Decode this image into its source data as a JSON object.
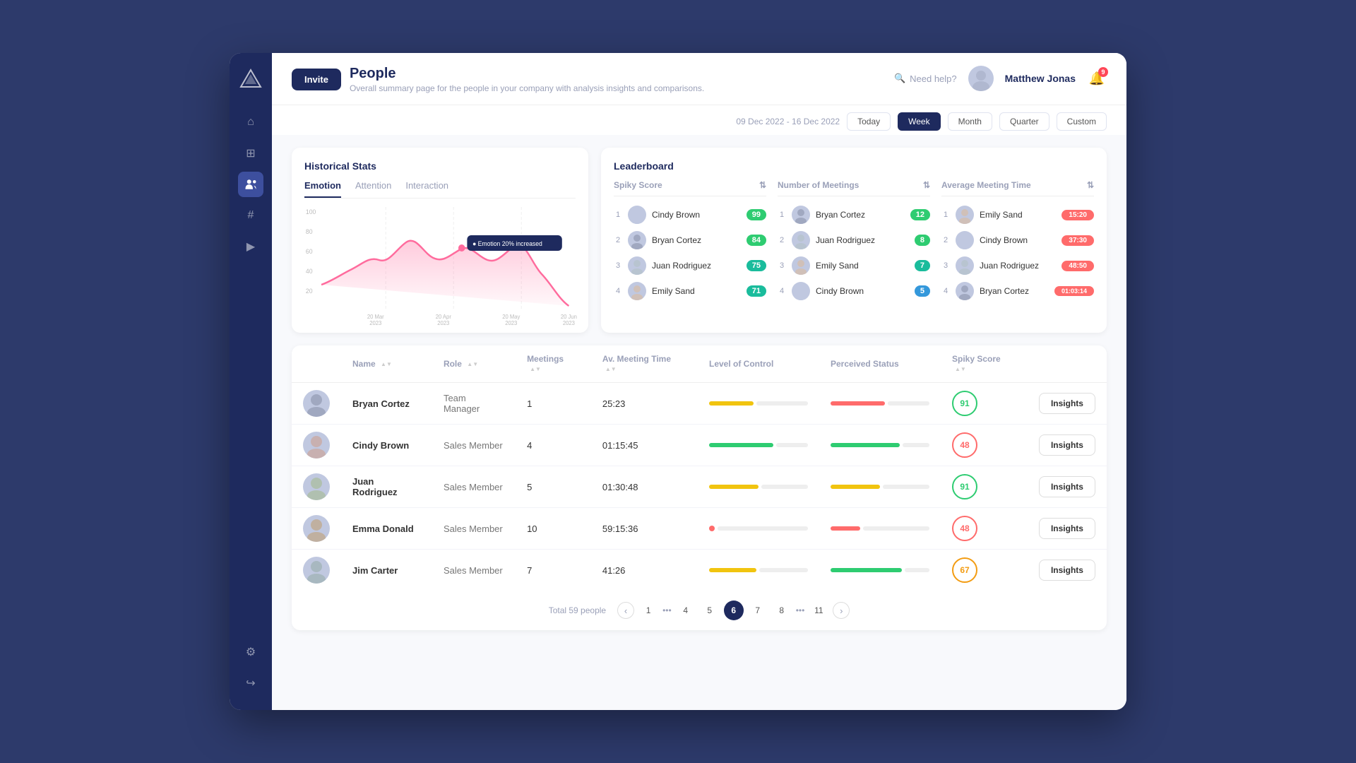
{
  "app": {
    "title": "People",
    "subtitle": "Overall summary page for the people in your company with analysis insights and comparisons."
  },
  "header": {
    "invite_label": "Invite",
    "search_label": "Need help?",
    "username": "Matthew Jonas",
    "notification_count": "9"
  },
  "date_filter": {
    "date_range": "09 Dec 2022 - 16 Dec 2022",
    "options": [
      "Today",
      "Week",
      "Month",
      "Quarter",
      "Custom"
    ],
    "active": "Week"
  },
  "historical_stats": {
    "title": "Historical Stats",
    "tabs": [
      "Emotion",
      "Attention",
      "Interaction"
    ],
    "active_tab": "Emotion",
    "tooltip": "Emotion 20% increased",
    "chart_x_labels": [
      "20 Mar\n2023",
      "20 Apr\n2023",
      "20 May\n2023",
      "20 Jun\n2023"
    ],
    "chart_y_labels": [
      "100",
      "80",
      "60",
      "40",
      "20"
    ]
  },
  "leaderboard": {
    "title": "Leaderboard",
    "columns": [
      {
        "header": "Spiky Score",
        "rows": [
          {
            "rank": "1",
            "name": "Cindy Brown",
            "score": "99",
            "color": "green"
          },
          {
            "rank": "2",
            "name": "Bryan Cortez",
            "score": "84",
            "color": "green"
          },
          {
            "rank": "3",
            "name": "Juan Rodriguez",
            "score": "75",
            "color": "teal"
          },
          {
            "rank": "4",
            "name": "Emily Sand",
            "score": "71",
            "color": "teal"
          }
        ]
      },
      {
        "header": "Number of Meetings",
        "rows": [
          {
            "rank": "1",
            "name": "Bryan Cortez",
            "score": "12",
            "color": "green"
          },
          {
            "rank": "2",
            "name": "Juan Rodriguez",
            "score": "8",
            "color": "green"
          },
          {
            "rank": "3",
            "name": "Emily Sand",
            "score": "7",
            "color": "teal"
          },
          {
            "rank": "4",
            "name": "Cindy Brown",
            "score": "5",
            "color": "blue"
          }
        ]
      },
      {
        "header": "Average Meeting Time",
        "rows": [
          {
            "rank": "1",
            "name": "Emily Sand",
            "score": "15:20",
            "color": "red"
          },
          {
            "rank": "2",
            "name": "Cindy Brown",
            "score": "37:30",
            "color": "red"
          },
          {
            "rank": "3",
            "name": "Juan Rodriguez",
            "score": "48:50",
            "color": "red"
          },
          {
            "rank": "4",
            "name": "Bryan Cortez",
            "score": "01:03:14",
            "color": "red"
          }
        ]
      }
    ]
  },
  "table": {
    "columns": [
      "Name",
      "Role",
      "Meetings",
      "Av. Meeting Time",
      "Level of Control",
      "Perceived Status",
      "Spiky Score",
      ""
    ],
    "rows": [
      {
        "name": "Bryan Cortez",
        "role": "Team Manager",
        "meetings": "1",
        "avg_time": "25:23",
        "loc_fill": 45,
        "loc_color": "#f1c40f",
        "ps_fill": 55,
        "ps_color": "#ff6b6b",
        "score": "91",
        "score_color": "#2ecc71",
        "insights": "Insights"
      },
      {
        "name": "Cindy Brown",
        "role": "Sales Member",
        "meetings": "4",
        "avg_time": "01:15:45",
        "loc_fill": 65,
        "loc_color": "#2ecc71",
        "ps_fill": 70,
        "ps_color": "#2ecc71",
        "score": "48",
        "score_color": "#ff6b6b",
        "insights": "Insights"
      },
      {
        "name": "Juan Rodriguez",
        "role": "Sales Member",
        "meetings": "5",
        "avg_time": "01:30:48",
        "loc_fill": 50,
        "loc_color": "#f1c40f",
        "ps_fill": 50,
        "ps_color": "#f1c40f",
        "score": "91",
        "score_color": "#2ecc71",
        "insights": "Insights"
      },
      {
        "name": "Emma Donald",
        "role": "Sales Member",
        "meetings": "10",
        "avg_time": "59:15:36",
        "loc_fill": 8,
        "loc_color": "#ff6b6b",
        "ps_fill": 30,
        "ps_color": "#ff6b6b",
        "score": "48",
        "score_color": "#ff6b6b",
        "insights": "Insights"
      },
      {
        "name": "Jim Carter",
        "role": "Sales Member",
        "meetings": "7",
        "avg_time": "41:26",
        "loc_fill": 48,
        "loc_color": "#f1c40f",
        "ps_fill": 72,
        "ps_color": "#2ecc71",
        "score": "67",
        "score_color": "#f39c12",
        "insights": "Insights"
      }
    ]
  },
  "pagination": {
    "total": "Total 59 people",
    "pages": [
      "1",
      "...",
      "4",
      "5",
      "6",
      "7",
      "8",
      "...",
      "11"
    ],
    "active": "6"
  },
  "sidebar": {
    "items": [
      {
        "icon": "⌂",
        "name": "home"
      },
      {
        "icon": "⊞",
        "name": "grid"
      },
      {
        "icon": "👤",
        "name": "people"
      },
      {
        "icon": "#",
        "name": "hashtag"
      },
      {
        "icon": "▶",
        "name": "play"
      }
    ],
    "bottom": [
      {
        "icon": "⚙",
        "name": "settings"
      },
      {
        "icon": "↪",
        "name": "logout"
      }
    ]
  }
}
